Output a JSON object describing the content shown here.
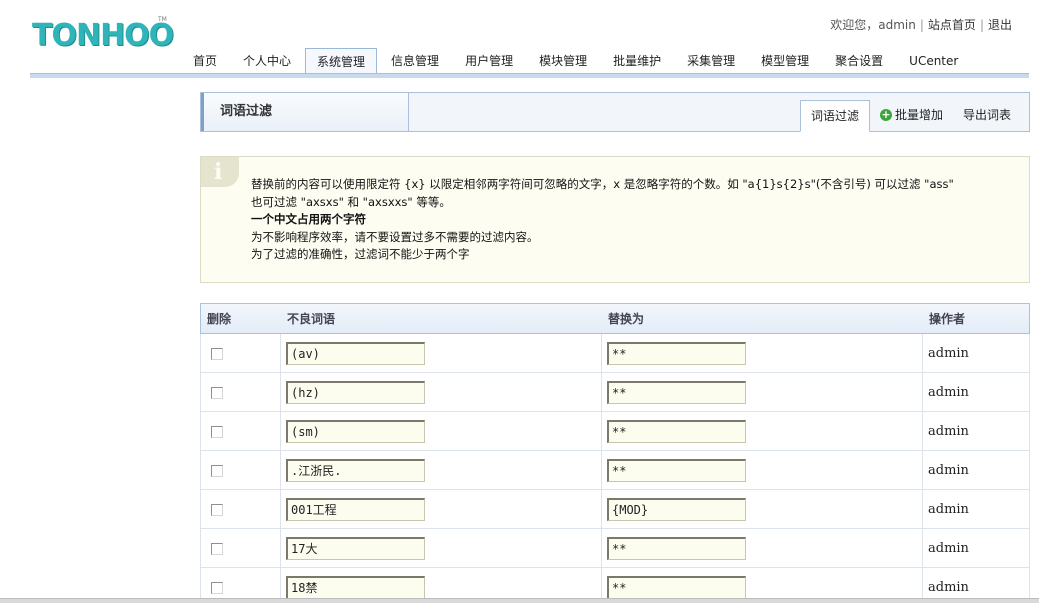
{
  "logo": {
    "text": "TONHOO",
    "tm": "TM"
  },
  "toplinks": {
    "welcome": "欢迎您，admin",
    "home": "站点首页",
    "logout": "退出"
  },
  "nav": [
    {
      "label": "首页"
    },
    {
      "label": "个人中心"
    },
    {
      "label": "系统管理",
      "active": true
    },
    {
      "label": "信息管理"
    },
    {
      "label": "用户管理"
    },
    {
      "label": "模块管理"
    },
    {
      "label": "批量维护"
    },
    {
      "label": "采集管理"
    },
    {
      "label": "模型管理"
    },
    {
      "label": "聚合设置"
    },
    {
      "label": "UCenter"
    }
  ],
  "page_title": "词语过滤",
  "tabs": {
    "filter": "词语过滤",
    "batch_add": "批量增加",
    "export": "导出词表"
  },
  "notice": {
    "line1": "替换前的内容可以使用限定符 {x} 以限定相邻两字符间可忽略的文字，x 是忽略字符的个数。如 \"a{1}s{2}s\"(不含引号) 可以过滤 \"ass\"",
    "line2": "也可过滤 \"axsxs\" 和 \"axsxxs\" 等等。",
    "line3": "一个中文占用两个字符",
    "line4": "为不影响程序效率，请不要设置过多不需要的过滤内容。",
    "line5": "为了过滤的准确性，过滤词不能少于两个字"
  },
  "table": {
    "headers": {
      "delete": "删除",
      "word": "不良词语",
      "replace": "替换为",
      "operator": "操作者"
    },
    "rows": [
      {
        "word": "(av)",
        "replace": "**",
        "operator": "admin"
      },
      {
        "word": "(hz)",
        "replace": "**",
        "operator": "admin"
      },
      {
        "word": "(sm)",
        "replace": "**",
        "operator": "admin"
      },
      {
        "word": ".江浙民.",
        "replace": "**",
        "operator": "admin"
      },
      {
        "word": "001工程",
        "replace": "{MOD}",
        "operator": "admin"
      },
      {
        "word": "17大",
        "replace": "**",
        "operator": "admin"
      },
      {
        "word": "18禁",
        "replace": "**",
        "operator": "admin"
      }
    ]
  }
}
